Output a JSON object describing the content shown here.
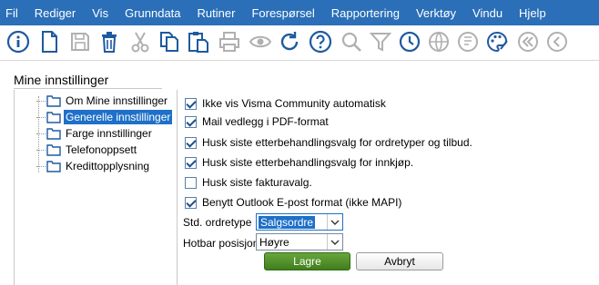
{
  "menu": [
    {
      "label": "Fil",
      "icon": "",
      "mn": "F"
    },
    {
      "label": "Rediger",
      "mn": "R"
    },
    {
      "label": "Vis",
      "mn": "V"
    },
    {
      "label": "Grunndata",
      "mn": "G"
    },
    {
      "label": "Rutiner",
      "mn": "u"
    },
    {
      "label": "Forespørsel",
      "mn": "o"
    },
    {
      "label": "Rapportering",
      "mn": "a"
    },
    {
      "label": "Verktøy",
      "mn": "k"
    },
    {
      "label": "Vindu",
      "mn": "n"
    },
    {
      "label": "Hjelp",
      "mn": "H"
    }
  ],
  "menu_text": [
    "Fil",
    "Rediger",
    "Vis",
    "Grunndata",
    "Rutiner",
    "Forespørsel",
    "Rapportering",
    "Verktøy",
    "Vindu",
    "Hjelp"
  ],
  "toolbar": [
    "info-icon",
    "new-document-icon",
    "save-icon",
    "delete-icon",
    "cut-icon",
    "copy-icon",
    "paste-icon",
    "print-icon",
    "preview-icon",
    "refresh-icon",
    "help-icon",
    "find-icon",
    "filter-icon",
    "history-icon",
    "web-icon",
    "report-icon",
    "theme-icon",
    "first-record-icon",
    "previous-record-icon"
  ],
  "colors": {
    "menubar": "#2a6fb8",
    "accent": "#1e70c8",
    "save_button": "#4f8f28"
  },
  "page": {
    "title": "Mine innstillinger"
  },
  "tree": [
    {
      "label": "Om Mine innstillinger",
      "selected": false
    },
    {
      "label": "Generelle innstillinger",
      "selected": true
    },
    {
      "label": "Farge innstillinger",
      "selected": false
    },
    {
      "label": "Telefonoppsett",
      "selected": false
    },
    {
      "label": "Kredittopplysning",
      "selected": false
    }
  ],
  "settings": [
    {
      "label": "Ikke vis Visma Community automatisk",
      "checked": true
    },
    {
      "label": "Mail vedlegg i PDF-format",
      "checked": true
    },
    {
      "label": "Husk siste etterbehandlingsvalg for ordretyper og tilbud.",
      "checked": true
    },
    {
      "label": "Husk siste etterbehandlingsvalg for innkjøp.",
      "checked": true
    },
    {
      "label": "Husk siste fakturavalg.",
      "checked": false
    },
    {
      "label": "Benytt Outlook E-post format (ikke MAPI)",
      "checked": true
    }
  ],
  "fields": {
    "ordretype_label": "Std. ordretype",
    "ordretype_value": "Salgsordre",
    "hotbar_label": "Hotbar posisjon",
    "hotbar_value": "Høyre"
  },
  "buttons": {
    "save": "Lagre",
    "cancel": "Avbryt"
  }
}
